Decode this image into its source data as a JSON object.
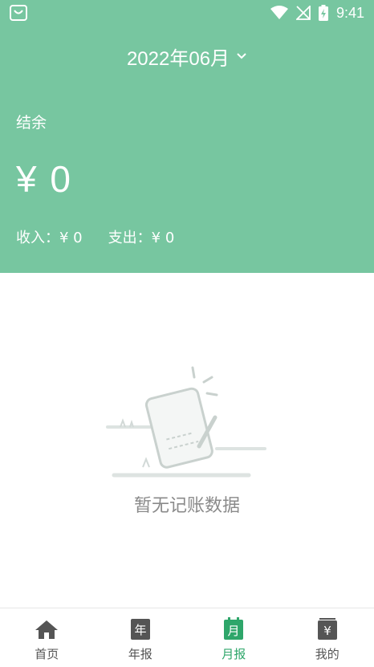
{
  "status_bar": {
    "time": "9:41"
  },
  "header": {
    "month": "2022年06月",
    "balance_label": "结余",
    "balance_value": "¥ 0",
    "income": "收入：¥ 0",
    "expense": "支出：¥ 0"
  },
  "empty": {
    "message": "暂无记账数据"
  },
  "tabbar": {
    "tabs": [
      {
        "label": "首页",
        "icon": "home-icon"
      },
      {
        "label": "年报",
        "icon": "calendar-year-icon",
        "glyph": "年"
      },
      {
        "label": "月报",
        "icon": "calendar-month-icon",
        "glyph": "月"
      },
      {
        "label": "我的",
        "icon": "wallet-icon",
        "glyph": "¥"
      }
    ],
    "active": "月报"
  },
  "colors": {
    "header_bg": "#77c6a0",
    "accent": "#2ea66a",
    "inactive_icon": "#555555"
  }
}
